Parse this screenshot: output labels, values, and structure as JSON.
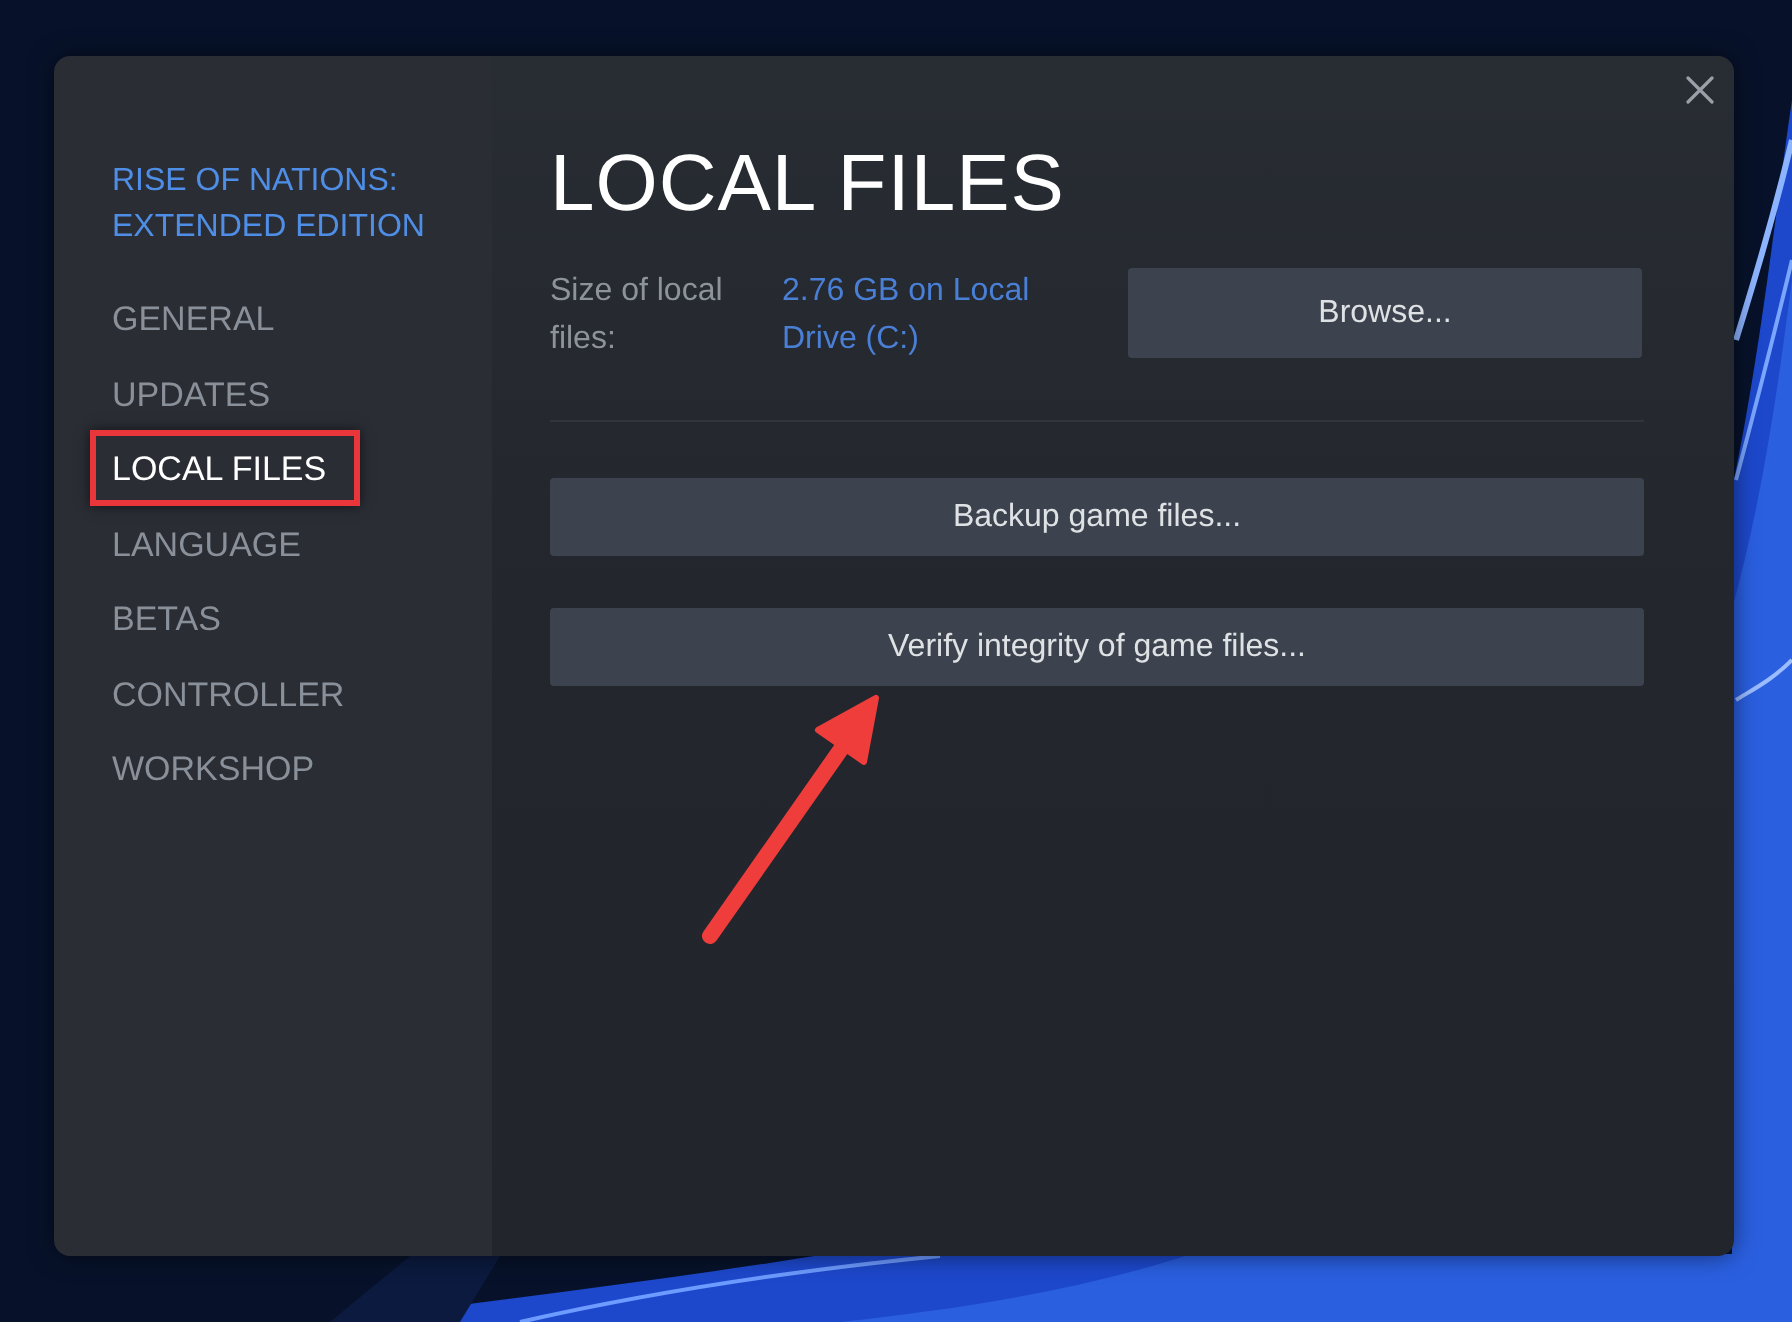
{
  "sidebar": {
    "game_title": "RISE OF NATIONS: EXTENDED EDITION",
    "items": [
      {
        "label": "GENERAL",
        "selected": false,
        "highlighted": false
      },
      {
        "label": "UPDATES",
        "selected": false,
        "highlighted": false
      },
      {
        "label": "LOCAL FILES",
        "selected": true,
        "highlighted": true
      },
      {
        "label": "LANGUAGE",
        "selected": false,
        "highlighted": false
      },
      {
        "label": "BETAS",
        "selected": false,
        "highlighted": false
      },
      {
        "label": "CONTROLLER",
        "selected": false,
        "highlighted": false
      },
      {
        "label": "WORKSHOP",
        "selected": false,
        "highlighted": false
      }
    ]
  },
  "main": {
    "title": "LOCAL FILES",
    "size_label": "Size of local files:",
    "size_value": "2.76 GB on Local Drive (C:)",
    "browse_button": "Browse...",
    "actions": [
      {
        "label": "Backup game files...",
        "arrow": false
      },
      {
        "label": "Verify integrity of game files...",
        "arrow": true
      }
    ]
  }
}
